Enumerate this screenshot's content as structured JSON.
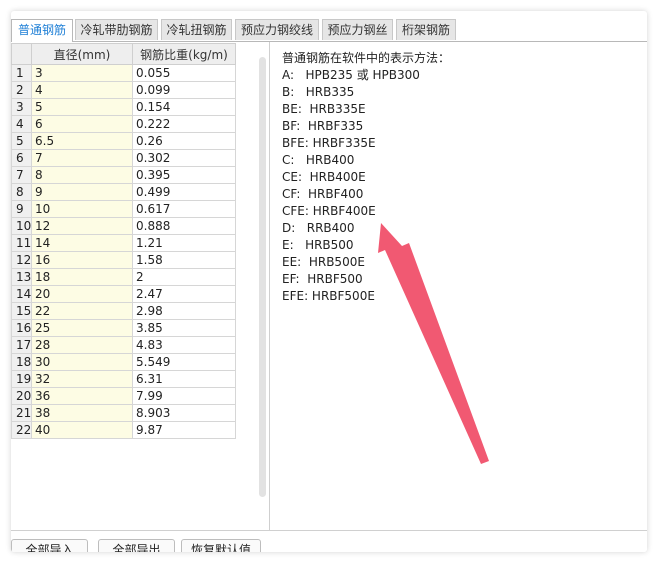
{
  "tabs": [
    {
      "label": "普通钢筋",
      "active": true
    },
    {
      "label": "冷轧带肋钢筋",
      "active": false
    },
    {
      "label": "冷轧扭钢筋",
      "active": false
    },
    {
      "label": "预应力钢绞线",
      "active": false
    },
    {
      "label": "预应力钢丝",
      "active": false
    },
    {
      "label": "桁架钢筋",
      "active": false
    }
  ],
  "table": {
    "headers": [
      "",
      "直径(mm)",
      "钢筋比重(kg/m)"
    ],
    "rows": [
      [
        "1",
        "3",
        "0.055"
      ],
      [
        "2",
        "4",
        "0.099"
      ],
      [
        "3",
        "5",
        "0.154"
      ],
      [
        "4",
        "6",
        "0.222"
      ],
      [
        "5",
        "6.5",
        "0.26"
      ],
      [
        "6",
        "7",
        "0.302"
      ],
      [
        "7",
        "8",
        "0.395"
      ],
      [
        "8",
        "9",
        "0.499"
      ],
      [
        "9",
        "10",
        "0.617"
      ],
      [
        "10",
        "12",
        "0.888"
      ],
      [
        "11",
        "14",
        "1.21"
      ],
      [
        "12",
        "16",
        "1.58"
      ],
      [
        "13",
        "18",
        "2"
      ],
      [
        "14",
        "20",
        "2.47"
      ],
      [
        "15",
        "22",
        "2.98"
      ],
      [
        "16",
        "25",
        "3.85"
      ],
      [
        "17",
        "28",
        "4.83"
      ],
      [
        "18",
        "30",
        "5.549"
      ],
      [
        "19",
        "32",
        "6.31"
      ],
      [
        "20",
        "36",
        "7.99"
      ],
      [
        "21",
        "38",
        "8.903"
      ],
      [
        "22",
        "40",
        "9.87"
      ]
    ]
  },
  "info": {
    "title": "普通钢筋在软件中的表示方法：",
    "lines": [
      "A:   HPB235 或 HPB300",
      "B:   HRB335",
      "BE:  HRB335E",
      "BF:  HRBF335",
      "BFE: HRBF335E",
      "C:   HRB400",
      "CE:  HRB400E",
      "CF:  HRBF400",
      "CFE: HRBF400E",
      "D:   RRB400",
      "E:   HRB500",
      "EE:  HRB500E",
      "EF:  HRBF500",
      "EFE: HRBF500E"
    ]
  },
  "buttons": {
    "import_all": "全部导入",
    "export_all": "全部导出",
    "restore_default": "恢复默认值"
  },
  "colors": {
    "active_tab_text": "#1e7fd6",
    "diameter_cell_bg": "#fdfce4",
    "annotation_arrow": "#f0506a"
  }
}
